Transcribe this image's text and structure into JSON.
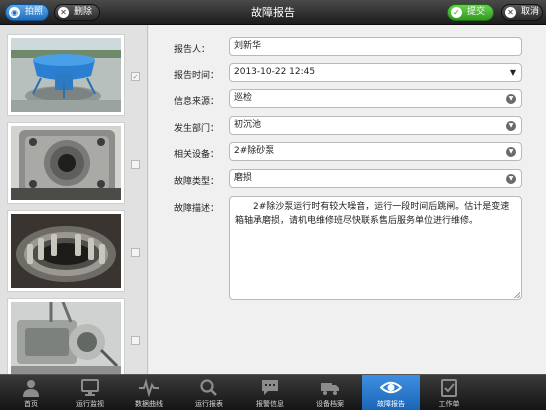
{
  "toolbar": {
    "photo_label": "拍照",
    "delete_label": "删除",
    "title": "故障报告",
    "submit_label": "提交",
    "cancel_label": "取消"
  },
  "form": {
    "reporter": {
      "label": "报告人：",
      "value": "刘新华"
    },
    "report_time": {
      "label": "报告时间：",
      "value": "2013-10-22 12:45"
    },
    "info_source": {
      "label": "信息来源：",
      "value": "巡检"
    },
    "department": {
      "label": "发生部门：",
      "value": "初沉池"
    },
    "equipment": {
      "label": "相关设备：",
      "value": "2#除砂泵"
    },
    "fault_type": {
      "label": "故障类型：",
      "value": "磨损"
    },
    "description": {
      "label": "故障描述：",
      "value": "2#除沙泵运行时有较大噪音，运行一段时间后跳闸。估计是变速箱轴承磨损，请机电维修班尽快联系售后服务单位进行维修。"
    }
  },
  "photos": [
    {
      "subject": "blue-pump-photo",
      "checked": true
    },
    {
      "subject": "gear-flange-photo",
      "checked": false
    },
    {
      "subject": "bearing-photo",
      "checked": false
    },
    {
      "subject": "gearbox-motor-photo",
      "checked": false
    }
  ],
  "nav": [
    {
      "label": "首页",
      "icon": "person-icon"
    },
    {
      "label": "运行监视",
      "icon": "monitor-icon"
    },
    {
      "label": "数据曲线",
      "icon": "waveform-icon"
    },
    {
      "label": "运行报表",
      "icon": "magnifier-icon"
    },
    {
      "label": "报警信息",
      "icon": "chat-bubble-icon"
    },
    {
      "label": "设备档案",
      "icon": "truck-icon"
    },
    {
      "label": "故障报告",
      "icon": "eye-icon",
      "active": true
    },
    {
      "label": "工作单",
      "icon": "checklist-icon"
    }
  ],
  "colors": {
    "accent": "#1f6fbf",
    "submit_green": "#2f9a1e",
    "topbar": "#1c1c1c"
  }
}
